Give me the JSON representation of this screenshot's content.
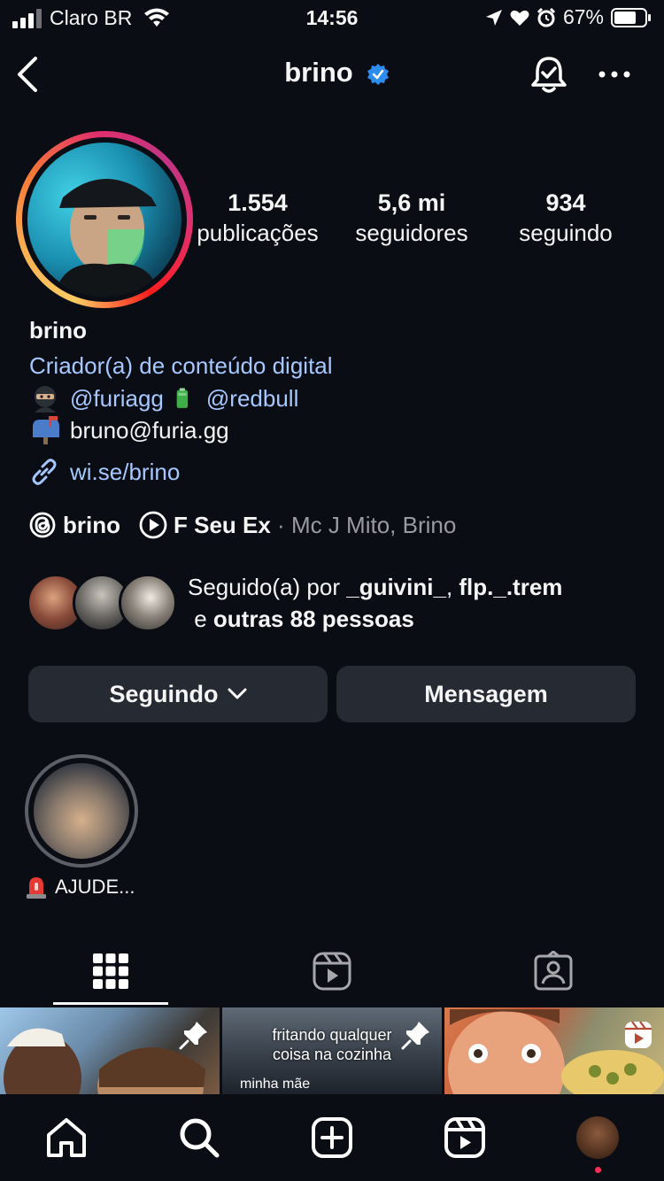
{
  "status_bar": {
    "carrier": "Claro BR",
    "time": "14:56",
    "battery": "67%"
  },
  "header": {
    "username": "brino"
  },
  "stats": {
    "posts_value": "1.554",
    "posts_label": "publicações",
    "followers_value": "5,6 mi",
    "followers_label": "seguidores",
    "following_value": "934",
    "following_label": "seguindo"
  },
  "bio": {
    "name": "brino",
    "category": "Criador(a) de conteúdo digital",
    "mention1": "@furiagg",
    "mention2": "@redbull",
    "email": "bruno@furia.gg",
    "link": "wi.se/brino"
  },
  "threads": {
    "username": "brino",
    "song": "F Seu Ex",
    "separator": " · ",
    "artists": "Mc J Mito, Brino"
  },
  "followed_by": {
    "prefix": "Seguido(a) por ",
    "user1": "_guivini_",
    "comma": ", ",
    "user2": "flp._.trem",
    "and": " e ",
    "others": "outras 88 pessoas"
  },
  "buttons": {
    "following": "Seguindo",
    "message": "Mensagem"
  },
  "highlights": [
    {
      "label": "AJUDE..."
    }
  ],
  "posts": [
    {
      "caption": ""
    },
    {
      "caption_line1": "fritando qualquer",
      "caption_line2": "coisa na cozinha",
      "caption_bottom": "minha mãe"
    },
    {
      "caption": ""
    }
  ],
  "colors": {
    "background": "#0b0d14",
    "link": "#a5c8ff",
    "verified": "#2d8cf0",
    "button": "#262a33",
    "notification_dot": "#ff2d55"
  },
  "icons": [
    "signal-icon",
    "wifi-icon",
    "location-icon",
    "heart-icon",
    "alarm-icon",
    "battery-icon",
    "back-icon",
    "verified-icon",
    "bell-icon",
    "more-icon",
    "ninja-emoji-icon",
    "battery-emoji-icon",
    "mailbox-emoji-icon",
    "link-icon",
    "threads-icon",
    "play-icon",
    "chevron-down-icon",
    "siren-emoji-icon",
    "grid-icon",
    "reels-icon",
    "tagged-icon",
    "pin-icon",
    "home-icon",
    "search-icon",
    "create-icon"
  ]
}
